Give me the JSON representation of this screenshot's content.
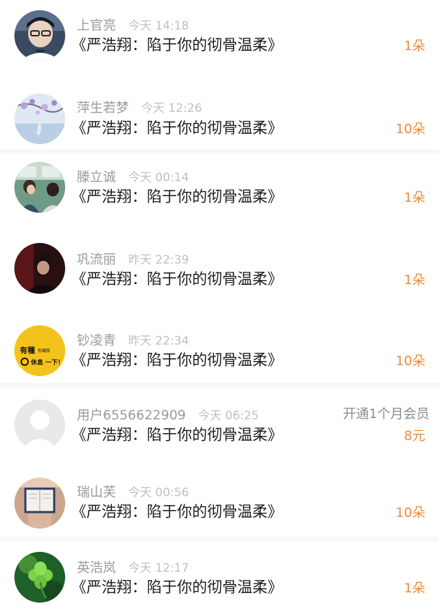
{
  "records": [
    {
      "name": "上官亮",
      "time": "今天 14:18",
      "title": "《严浩翔：陷于你的彻骨温柔》",
      "amount": "1朵",
      "avatar": "avatar-photo-boy-glasses"
    },
    {
      "name": "萍生若梦",
      "time": "今天 12:26",
      "title": "《严浩翔：陷于你的彻骨温柔》",
      "amount": "10朵",
      "avatar": "avatar-painting-blossoms"
    },
    {
      "name": "滕立诚",
      "time": "今天 00:14",
      "title": "《严浩翔：陷于你的彻骨温柔》",
      "amount": "1朵",
      "avatar": "avatar-photo-train-couple"
    },
    {
      "name": "巩流丽",
      "time": "昨天 22:39",
      "title": "《严浩翔：陷于你的彻骨温柔》",
      "amount": "1朵",
      "avatar": "avatar-photo-dark-portrait"
    },
    {
      "name": "钞凌青",
      "time": "昨天 22:34",
      "title": "《严浩翔：陷于你的彻骨温柔》",
      "amount": "10朵",
      "avatar": "avatar-yellow-sticker",
      "avatar_text": {
        "line1": "有種",
        "line1_small": "你讓我",
        "line2": "休息 一下！"
      }
    },
    {
      "name": "用户6556622909",
      "time": "今天 06:25",
      "title": "《严浩翔：陷于你的彻骨温柔》",
      "amount": "8元",
      "extra": "开通1个月会员",
      "avatar": "avatar-default-silhouette"
    },
    {
      "name": "瑞山芙",
      "time": "今天 00:56",
      "title": "《严浩翔：陷于你的彻骨温柔》",
      "amount": "10朵",
      "avatar": "avatar-photo-book"
    },
    {
      "name": "英浩岚",
      "time": "今天 12:17",
      "title": "《严浩翔：陷于你的彻骨温柔》",
      "amount": "1朵",
      "avatar": "avatar-photo-clover"
    }
  ],
  "colors": {
    "amount": "#ee8a3a",
    "name": "#9a9a9a",
    "time": "#c0c0c0",
    "title": "#1e1e1e"
  }
}
